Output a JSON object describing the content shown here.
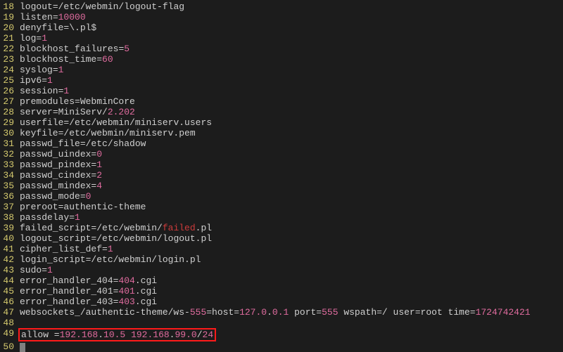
{
  "lines": [
    {
      "no": "18",
      "parts": [
        {
          "t": "logout",
          "c": "kw"
        },
        {
          "t": "=/etc/webmin/logout-flag",
          "c": "kw"
        }
      ]
    },
    {
      "no": "19",
      "parts": [
        {
          "t": "listen",
          "c": "kw"
        },
        {
          "t": "=",
          "c": "eq"
        },
        {
          "t": "10000",
          "c": "num"
        }
      ]
    },
    {
      "no": "20",
      "parts": [
        {
          "t": "denyfile",
          "c": "kw"
        },
        {
          "t": "=\\.pl$",
          "c": "kw"
        }
      ]
    },
    {
      "no": "21",
      "parts": [
        {
          "t": "log",
          "c": "kw"
        },
        {
          "t": "=",
          "c": "eq"
        },
        {
          "t": "1",
          "c": "num"
        }
      ]
    },
    {
      "no": "22",
      "parts": [
        {
          "t": "blockhost_failures",
          "c": "kw"
        },
        {
          "t": "=",
          "c": "eq"
        },
        {
          "t": "5",
          "c": "num"
        }
      ]
    },
    {
      "no": "23",
      "parts": [
        {
          "t": "blockhost_time",
          "c": "kw"
        },
        {
          "t": "=",
          "c": "eq"
        },
        {
          "t": "60",
          "c": "num"
        }
      ]
    },
    {
      "no": "24",
      "parts": [
        {
          "t": "syslog",
          "c": "kw"
        },
        {
          "t": "=",
          "c": "eq"
        },
        {
          "t": "1",
          "c": "num"
        }
      ]
    },
    {
      "no": "25",
      "parts": [
        {
          "t": "ipv6",
          "c": "kw"
        },
        {
          "t": "=",
          "c": "eq"
        },
        {
          "t": "1",
          "c": "num"
        }
      ]
    },
    {
      "no": "26",
      "parts": [
        {
          "t": "session",
          "c": "kw"
        },
        {
          "t": "=",
          "c": "eq"
        },
        {
          "t": "1",
          "c": "num"
        }
      ]
    },
    {
      "no": "27",
      "parts": [
        {
          "t": "premodules",
          "c": "kw"
        },
        {
          "t": "=WebminCore",
          "c": "kw"
        }
      ]
    },
    {
      "no": "28",
      "parts": [
        {
          "t": "server",
          "c": "kw"
        },
        {
          "t": "=MiniServ/",
          "c": "kw"
        },
        {
          "t": "2.202",
          "c": "num"
        }
      ]
    },
    {
      "no": "29",
      "parts": [
        {
          "t": "userfile",
          "c": "kw"
        },
        {
          "t": "=/etc/webmin/miniserv.users",
          "c": "kw"
        }
      ]
    },
    {
      "no": "30",
      "parts": [
        {
          "t": "keyfile",
          "c": "kw"
        },
        {
          "t": "=/etc/webmin/miniserv.pem",
          "c": "kw"
        }
      ]
    },
    {
      "no": "31",
      "parts": [
        {
          "t": "passwd_file",
          "c": "kw"
        },
        {
          "t": "=/etc/shadow",
          "c": "kw"
        }
      ]
    },
    {
      "no": "32",
      "parts": [
        {
          "t": "passwd_uindex",
          "c": "kw"
        },
        {
          "t": "=",
          "c": "eq"
        },
        {
          "t": "0",
          "c": "num"
        }
      ]
    },
    {
      "no": "33",
      "parts": [
        {
          "t": "passwd_pindex",
          "c": "kw"
        },
        {
          "t": "=",
          "c": "eq"
        },
        {
          "t": "1",
          "c": "num"
        }
      ]
    },
    {
      "no": "34",
      "parts": [
        {
          "t": "passwd_cindex",
          "c": "kw"
        },
        {
          "t": "=",
          "c": "eq"
        },
        {
          "t": "2",
          "c": "num"
        }
      ]
    },
    {
      "no": "35",
      "parts": [
        {
          "t": "passwd_mindex",
          "c": "kw"
        },
        {
          "t": "=",
          "c": "eq"
        },
        {
          "t": "4",
          "c": "num"
        }
      ]
    },
    {
      "no": "36",
      "parts": [
        {
          "t": "passwd_mode",
          "c": "kw"
        },
        {
          "t": "=",
          "c": "eq"
        },
        {
          "t": "0",
          "c": "num"
        }
      ]
    },
    {
      "no": "37",
      "parts": [
        {
          "t": "preroot",
          "c": "kw"
        },
        {
          "t": "=authentic-theme",
          "c": "kw"
        }
      ]
    },
    {
      "no": "38",
      "parts": [
        {
          "t": "passdelay",
          "c": "kw"
        },
        {
          "t": "=",
          "c": "eq"
        },
        {
          "t": "1",
          "c": "num"
        }
      ]
    },
    {
      "no": "39",
      "parts": [
        {
          "t": "failed_script",
          "c": "kw"
        },
        {
          "t": "=/etc/webmin/",
          "c": "kw"
        },
        {
          "t": "failed",
          "c": "red"
        },
        {
          "t": ".pl",
          "c": "kw"
        }
      ]
    },
    {
      "no": "40",
      "parts": [
        {
          "t": "logout_script",
          "c": "kw"
        },
        {
          "t": "=/etc/webmin/logout.pl",
          "c": "kw"
        }
      ]
    },
    {
      "no": "41",
      "parts": [
        {
          "t": "cipher_list_def",
          "c": "kw"
        },
        {
          "t": "=",
          "c": "eq"
        },
        {
          "t": "1",
          "c": "num"
        }
      ]
    },
    {
      "no": "42",
      "parts": [
        {
          "t": "login_script",
          "c": "kw"
        },
        {
          "t": "=/etc/webmin/login.pl",
          "c": "kw"
        }
      ]
    },
    {
      "no": "43",
      "parts": [
        {
          "t": "sudo",
          "c": "kw"
        },
        {
          "t": "=",
          "c": "eq"
        },
        {
          "t": "1",
          "c": "num"
        }
      ]
    },
    {
      "no": "44",
      "parts": [
        {
          "t": "error_handler_404",
          "c": "kw"
        },
        {
          "t": "=",
          "c": "eq"
        },
        {
          "t": "404",
          "c": "num"
        },
        {
          "t": ".cgi",
          "c": "kw"
        }
      ]
    },
    {
      "no": "45",
      "parts": [
        {
          "t": "error_handler_401",
          "c": "kw"
        },
        {
          "t": "=",
          "c": "eq"
        },
        {
          "t": "401",
          "c": "num"
        },
        {
          "t": ".cgi",
          "c": "kw"
        }
      ]
    },
    {
      "no": "46",
      "parts": [
        {
          "t": "error_handler_403",
          "c": "kw"
        },
        {
          "t": "=",
          "c": "eq"
        },
        {
          "t": "403",
          "c": "num"
        },
        {
          "t": ".cgi",
          "c": "kw"
        }
      ]
    },
    {
      "no": "47",
      "parts": [
        {
          "t": "websockets_/authentic-theme/ws-",
          "c": "kw"
        },
        {
          "t": "555",
          "c": "num"
        },
        {
          "t": "=host=",
          "c": "kw"
        },
        {
          "t": "127.0",
          "c": "num"
        },
        {
          "t": ".",
          "c": "kw"
        },
        {
          "t": "0.1",
          "c": "num"
        },
        {
          "t": " port=",
          "c": "kw"
        },
        {
          "t": "555",
          "c": "num"
        },
        {
          "t": " wspath=/ user=root time=",
          "c": "kw"
        },
        {
          "t": "1724742421",
          "c": "num"
        }
      ]
    },
    {
      "no": "48",
      "parts": []
    },
    {
      "no": "49",
      "boxed": true,
      "parts": [
        {
          "t": "allow =",
          "c": "kw"
        },
        {
          "t": "192.168",
          "c": "ip"
        },
        {
          "t": ".",
          "c": "kw"
        },
        {
          "t": "10.5",
          "c": "ip"
        },
        {
          "t": " ",
          "c": "kw"
        },
        {
          "t": "192.168",
          "c": "ip"
        },
        {
          "t": ".",
          "c": "kw"
        },
        {
          "t": "99.0",
          "c": "ip"
        },
        {
          "t": "/",
          "c": "kw"
        },
        {
          "t": "24",
          "c": "num"
        }
      ]
    },
    {
      "no": "50",
      "cursor": true,
      "parts": []
    }
  ]
}
